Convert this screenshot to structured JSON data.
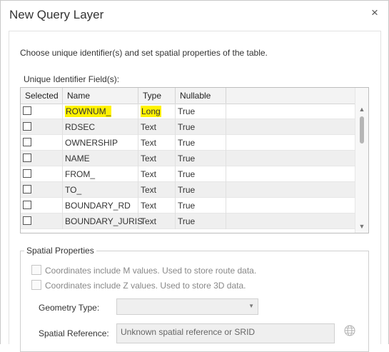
{
  "dialog": {
    "title": "New Query Layer",
    "close_glyph": "×",
    "intro": "Choose unique identifier(s) and set spatial properties of the table.",
    "unique_field_label": "Unique Identifier Field(s):"
  },
  "grid": {
    "columns": [
      "Selected",
      "Name",
      "Type",
      "Nullable"
    ],
    "rows": [
      {
        "name": "ROWNUM_",
        "type": "Long",
        "nullable": "True",
        "highlighted": true
      },
      {
        "name": "RDSEC",
        "type": "Text",
        "nullable": "True"
      },
      {
        "name": "OWNERSHIP",
        "type": "Text",
        "nullable": "True"
      },
      {
        "name": "NAME",
        "type": "Text",
        "nullable": "True"
      },
      {
        "name": "FROM_",
        "type": "Text",
        "nullable": "True"
      },
      {
        "name": "TO_",
        "type": "Text",
        "nullable": "True"
      },
      {
        "name": "BOUNDARY_RD",
        "type": "Text",
        "nullable": "True"
      },
      {
        "name": "BOUNDARY_JURIS",
        "type": "Text",
        "nullable": "True"
      }
    ],
    "highlight_color": "#fff200"
  },
  "spatial": {
    "legend": "Spatial Properties",
    "m_values_label": "Coordinates include M values. Used to store route data.",
    "z_values_label": "Coordinates include Z values. Used to store 3D data.",
    "geometry_type_label": "Geometry Type:",
    "geometry_type_value": "",
    "spatial_reference_label": "Spatial Reference:",
    "spatial_reference_value": "Unknown spatial reference or SRID"
  },
  "icons": {
    "close": "close-icon",
    "dropdown": "chevron-down-icon",
    "globe": "globe-icon"
  }
}
